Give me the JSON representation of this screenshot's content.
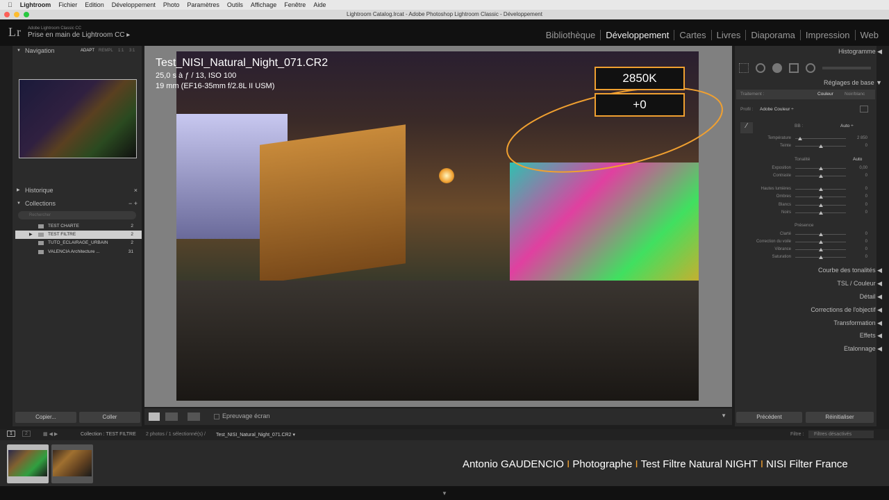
{
  "macmenu": {
    "apple": "",
    "app": "Lightroom",
    "items": [
      "Fichier",
      "Edition",
      "Développement",
      "Photo",
      "Paramètres",
      "Outils",
      "Affichage",
      "Fenêtre",
      "Aide"
    ]
  },
  "window_title": "Lightroom Catalog.lrcat - Adobe Photoshop Lightroom Classic - Développement",
  "identity": {
    "logo": "Lr",
    "small": "Adobe Lightroom Classic CC",
    "title": "Prise en main de Lightroom CC ▸"
  },
  "modules": [
    "Bibliothèque",
    "Développement",
    "Cartes",
    "Livres",
    "Diaporama",
    "Impression",
    "Web"
  ],
  "left": {
    "navigation": "Navigation",
    "nav_opts": [
      "ADAPT",
      "REMPL",
      "1:1",
      "3:1"
    ],
    "historique": "Historique",
    "collections": "Collections",
    "search_placeholder": "Rechercher",
    "collection_items": [
      {
        "name": "TEST CHARTE",
        "count": "2"
      },
      {
        "name": "TEST FILTRE",
        "count": "2"
      },
      {
        "name": "TUTO_ECLAIRAGE_URBAIN",
        "count": "2"
      },
      {
        "name": "VALENCIA Architecture ...",
        "count": "31"
      }
    ],
    "copy": "Copier...",
    "paste": "Coller"
  },
  "photo": {
    "name": "Test_NISI_Natural_Night_071.CR2",
    "info1": "25,0 s à ƒ / 13, ISO 100",
    "info2": "19 mm (EF16-35mm f/2.8L II USM)"
  },
  "callouts": {
    "temp": "2850K",
    "tint": "+0"
  },
  "toolbar": {
    "softproof": "Epreuvage écran"
  },
  "right": {
    "histogram": "Histogramme",
    "basic": "Réglages de base",
    "traitement": "Traitement :",
    "couleur": "Couleur",
    "nb": "Noir/blanc",
    "profil": "Profil :",
    "profil_val": "Adobe Couleur ÷",
    "bb": "BB :",
    "bb_val": "Auto ÷",
    "tonalite": "Tonalité",
    "tonalite_auto": "Auto",
    "presence": "Présence",
    "sliders": [
      {
        "label": "Température",
        "value": "2 850",
        "pos": 0.1
      },
      {
        "label": "Teinte",
        "value": "0",
        "pos": 0.5
      },
      {
        "label": "Exposition",
        "value": "0,00",
        "pos": 0.5
      },
      {
        "label": "Contraste",
        "value": "0",
        "pos": 0.5
      },
      {
        "label": "Hautes lumières",
        "value": "0",
        "pos": 0.5
      },
      {
        "label": "Ombres",
        "value": "0",
        "pos": 0.5
      },
      {
        "label": "Blancs",
        "value": "0",
        "pos": 0.5
      },
      {
        "label": "Noirs",
        "value": "0",
        "pos": 0.5
      },
      {
        "label": "Clarté",
        "value": "0",
        "pos": 0.5
      },
      {
        "label": "Correction du voile",
        "value": "0",
        "pos": 0.5
      },
      {
        "label": "Vibrance",
        "value": "0",
        "pos": 0.5
      },
      {
        "label": "Saturation",
        "value": "0",
        "pos": 0.5
      }
    ],
    "sections": [
      "Courbe des tonalités",
      "TSL / Couleur",
      "Détail",
      "Corrections de l'objectif",
      "Transformation",
      "Effets",
      "Etalonnage"
    ],
    "prev": "Précédent",
    "reset": "Réinitialiser"
  },
  "filmbar": {
    "v1": "1",
    "v2": "2",
    "collection": "Collection : TEST FILTRE",
    "count": "2 photos / 1 sélectionné(s) /",
    "file": "Test_NISI_Natural_Night_071.CR2 ▾",
    "filter_label": "Filtre :",
    "filter_value": "Filtres désactivés"
  },
  "overlay": {
    "a": "Antonio GAUDENCIO",
    "b": "Photographe",
    "c": "Test Filtre Natural NIGHT",
    "d": "NISI Filter France",
    "sep": "I"
  }
}
